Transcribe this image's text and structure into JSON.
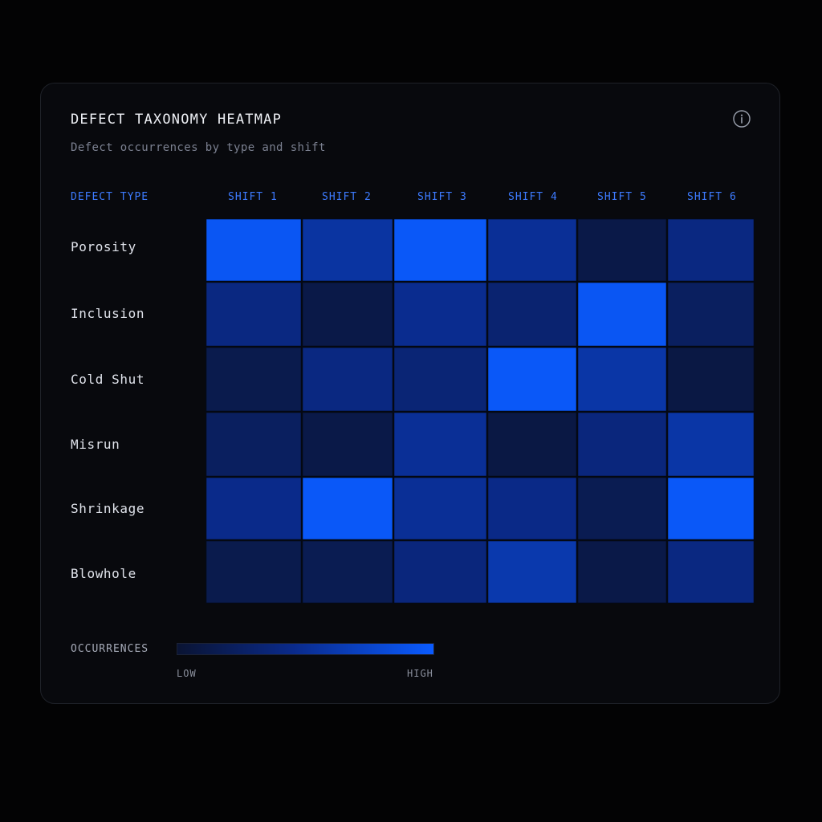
{
  "chart_data": {
    "type": "heatmap",
    "title": "DEFECT TAXONOMY HEATMAP",
    "subtitle": "Defect occurrences by type and shift",
    "row_header": "DEFECT TYPE",
    "columns": [
      "SHIFT 1",
      "SHIFT 2",
      "SHIFT 3",
      "SHIFT 4",
      "SHIFT 5",
      "SHIFT 6"
    ],
    "rows": [
      "Porosity",
      "Inclusion",
      "Cold Shut",
      "Misrun",
      "Shrinkage",
      "Blowhole"
    ],
    "values": [
      [
        0.95,
        0.6,
        0.97,
        0.55,
        0.12,
        0.45
      ],
      [
        0.45,
        0.12,
        0.52,
        0.35,
        0.95,
        0.25
      ],
      [
        0.15,
        0.45,
        0.38,
        0.97,
        0.62,
        0.1
      ],
      [
        0.25,
        0.12,
        0.55,
        0.1,
        0.42,
        0.62
      ],
      [
        0.5,
        0.97,
        0.55,
        0.48,
        0.18,
        0.97
      ],
      [
        0.15,
        0.18,
        0.42,
        0.65,
        0.12,
        0.45
      ]
    ],
    "scale": {
      "min": 0,
      "max": 1,
      "low_color": "#0a1433",
      "mid_color": "#0a2a8a",
      "high_color": "#0a5bff"
    },
    "legend": {
      "title": "OCCURRENCES",
      "low_label": "LOW",
      "high_label": "HIGH",
      "placement": "bottom-left"
    }
  },
  "icons": {
    "info": "info-icon"
  },
  "colors": {
    "accent": "#3d7bff",
    "background": "#030304",
    "card": "#08090d"
  }
}
